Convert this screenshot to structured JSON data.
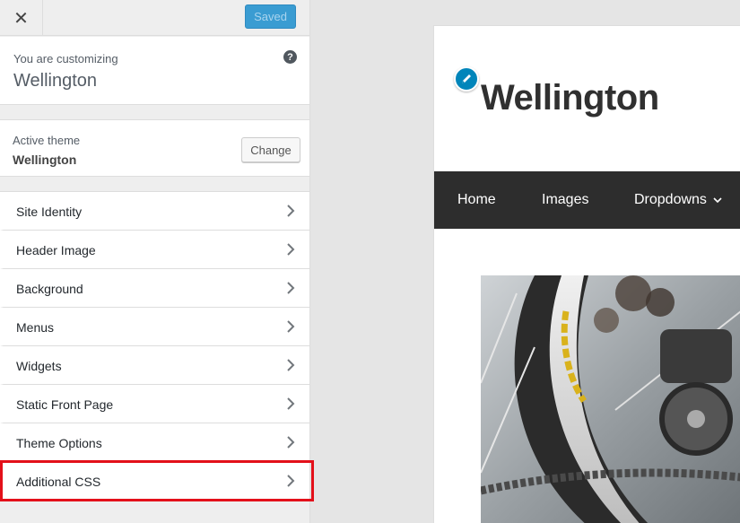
{
  "header": {
    "close_icon": "close-icon",
    "saved_label": "Saved"
  },
  "info": {
    "customizing_label": "You are customizing",
    "site_name": "Wellington",
    "help_icon": "question-mark-icon"
  },
  "theme": {
    "label": "Active theme",
    "name": "Wellington",
    "change_label": "Change"
  },
  "sections": [
    {
      "label": "Site Identity"
    },
    {
      "label": "Header Image"
    },
    {
      "label": "Background"
    },
    {
      "label": "Menus"
    },
    {
      "label": "Widgets"
    },
    {
      "label": "Static Front Page"
    },
    {
      "label": "Theme Options"
    },
    {
      "label": "Additional CSS"
    }
  ],
  "highlight": {
    "target": "Additional CSS",
    "color": "#e3101a"
  },
  "preview": {
    "site_title": "Wellington",
    "edit_icon": "pencil-icon",
    "nav": {
      "home": "Home",
      "images": "Images",
      "dropdowns": "Dropdowns"
    }
  },
  "colors": {
    "accent": "#3a9cd2",
    "nav_bg": "#2d2d2d",
    "edit_button": "#0085ba"
  }
}
